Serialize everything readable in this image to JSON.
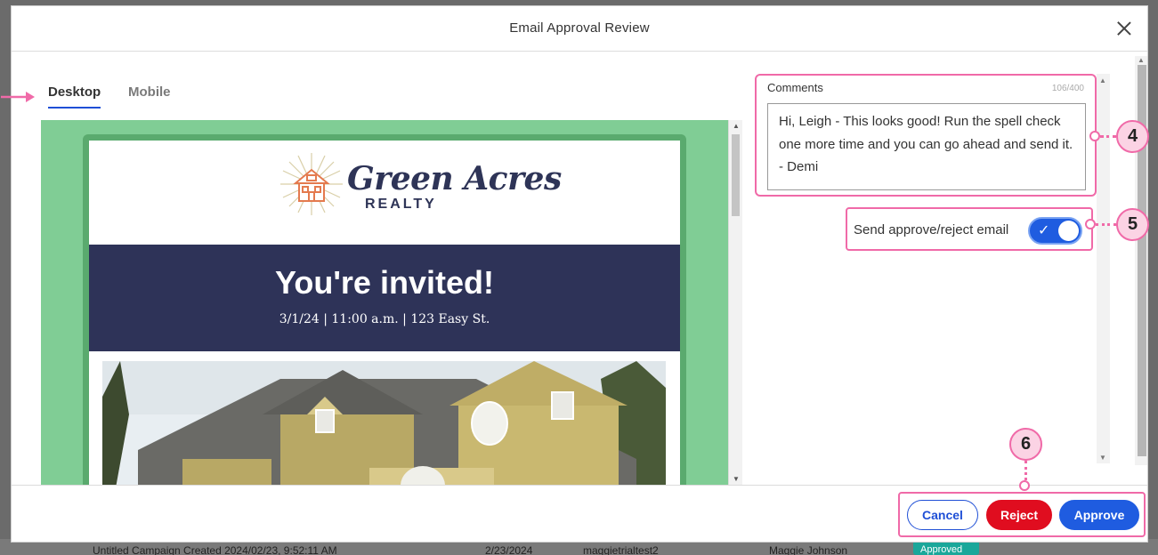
{
  "dialog": {
    "title": "Email Approval Review"
  },
  "tabs": [
    {
      "label": "Desktop",
      "active": true
    },
    {
      "label": "Mobile",
      "active": false
    }
  ],
  "preview": {
    "logo_main": "Green Acres",
    "logo_sub": "REALTY",
    "headline": "You're invited!",
    "details": "3/1/24 | 11:00 a.m. | 123 Easy St."
  },
  "comments": {
    "label": "Comments",
    "count": "106/400",
    "value": "Hi, Leigh - This looks good! Run the spell check one more time and you can go ahead and send it.    - Demi"
  },
  "send_email": {
    "label": "Send approve/reject email",
    "enabled": true
  },
  "actions": {
    "cancel": "Cancel",
    "reject": "Reject",
    "approve": "Approve"
  },
  "callouts": {
    "comments": "4",
    "toggle": "5",
    "actions": "6"
  },
  "background_row": {
    "campaign": "Untitled Campaign Created 2024/02/23, 9:52:11 AM",
    "date": "2/23/2024",
    "account": "maggietrialtest2",
    "owner": "Maggie Johnson",
    "status": "Approved"
  },
  "colors": {
    "accent_blue": "#1f5ce0",
    "reject_red": "#e00d1f",
    "callout_pink": "#f06aa8",
    "preview_green": "#80cd95",
    "banner_navy": "#2e3358"
  }
}
